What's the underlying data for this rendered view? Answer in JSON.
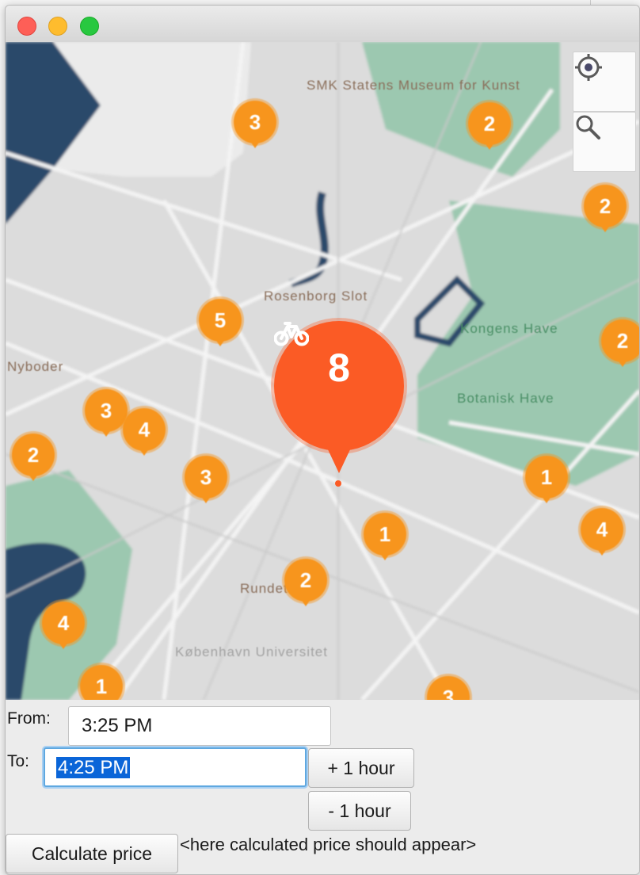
{
  "window": {
    "controls": [
      "close",
      "minimize",
      "zoom"
    ]
  },
  "map": {
    "labels": [
      {
        "text": "SMK Statens Museum for Kunst",
        "style": "brown"
      },
      {
        "text": "Kongens Have",
        "style": "brown"
      },
      {
        "text": "Rosenborg Slot",
        "style": "brown"
      },
      {
        "text": "Nyboder",
        "style": "brown"
      },
      {
        "text": "Rundetaarn",
        "style": "brown"
      },
      {
        "text": "København Universitet",
        "style": "gray"
      },
      {
        "text": "Botanisk Have",
        "style": "green"
      }
    ],
    "clusters": [
      "3",
      "2",
      "2",
      "5",
      "2",
      "3",
      "4",
      "2",
      "3",
      "1",
      "1",
      "4",
      "2",
      "4",
      "1",
      "3",
      "8"
    ],
    "big_cluster": {
      "count": "8",
      "icon": "bike-icon"
    },
    "controls": {
      "locate_icon": "locate-icon",
      "zoom_icon": "zoom-icon"
    },
    "colors": {
      "cluster": "#f7951d",
      "big_cluster": "#fb5b25",
      "park": "#9cc8b0",
      "water": "#2b4a6b"
    }
  },
  "form": {
    "from_label": "From:",
    "from_value": "3:25 PM",
    "to_label": "To:",
    "to_value": "4:25 PM",
    "plus_hour": "+ 1 hour",
    "minus_hour": "- 1 hour",
    "calculate": "Calculate price",
    "result_placeholder": "<here calculated price should appear>"
  }
}
